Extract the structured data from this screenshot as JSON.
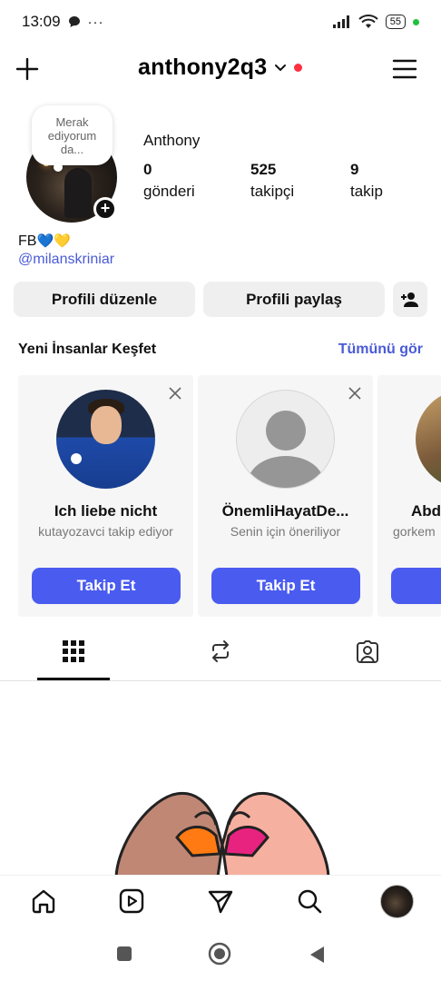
{
  "status_bar": {
    "time": "13:09",
    "extras": "• ···",
    "battery": "55"
  },
  "header": {
    "username": "anthony2q3"
  },
  "profile": {
    "note": "Merak ediyorum da...",
    "display_name": "Anthony",
    "stats": [
      {
        "value": "0",
        "label": "gönderi"
      },
      {
        "value": "525",
        "label": "takipçi"
      },
      {
        "value": "9",
        "label": "takip"
      }
    ],
    "bio_text": "FB",
    "bio_emoji": "💙💛",
    "bio_handle": "@milanskriniar"
  },
  "actions": {
    "edit_label": "Profili düzenle",
    "share_label": "Profili paylaş"
  },
  "discover": {
    "title": "Yeni İnsanlar Keşfet",
    "see_all": "Tümünü gör",
    "cards": [
      {
        "name": "Ich liebe nicht",
        "subtitle": "kutayozavci takip ediyor",
        "button": "Takip Et"
      },
      {
        "name": "ÖnemliHayatDe...",
        "subtitle": "Senin için öneriliyor",
        "button": "Takip Et"
      },
      {
        "name": "Abd",
        "subtitle": "gorkem",
        "button": "T"
      }
    ]
  },
  "colors": {
    "accent": "#4a5bf0",
    "link": "#4a5bd6",
    "notification": "#ff3040"
  }
}
